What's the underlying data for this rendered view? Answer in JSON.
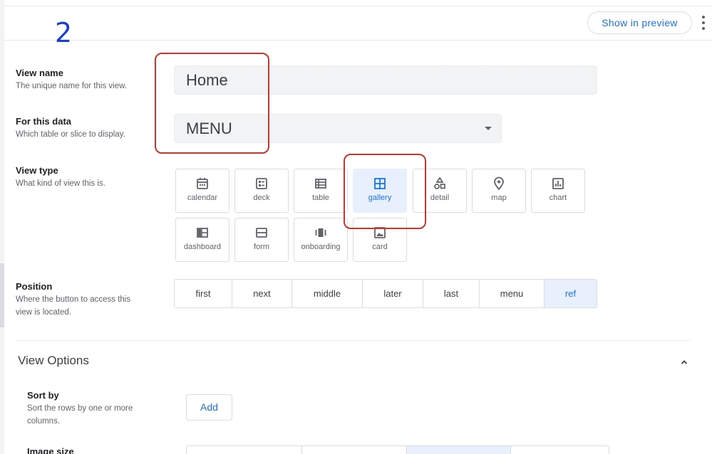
{
  "annotation": {
    "step_number": "2"
  },
  "header": {
    "show_in_preview_label": "Show in preview"
  },
  "view_name": {
    "title": "View name",
    "description": "The unique name for this view.",
    "value": "Home"
  },
  "for_this_data": {
    "title": "For this data",
    "description": "Which table or slice to display.",
    "value": "MENU"
  },
  "view_type": {
    "title": "View type",
    "description": "What kind of view this is.",
    "options": [
      {
        "label": "calendar",
        "icon": "calendar-icon"
      },
      {
        "label": "deck",
        "icon": "deck-icon"
      },
      {
        "label": "table",
        "icon": "table-icon"
      },
      {
        "label": "gallery",
        "icon": "gallery-icon"
      },
      {
        "label": "detail",
        "icon": "detail-icon"
      },
      {
        "label": "map",
        "icon": "map-pin-icon"
      },
      {
        "label": "chart",
        "icon": "chart-icon"
      },
      {
        "label": "dashboard",
        "icon": "dashboard-icon"
      },
      {
        "label": "form",
        "icon": "form-icon"
      },
      {
        "label": "onboarding",
        "icon": "onboarding-icon"
      },
      {
        "label": "card",
        "icon": "card-icon"
      }
    ],
    "selected": "gallery"
  },
  "position": {
    "title": "Position",
    "description_line1": "Where the button to access this",
    "description_line2": "view is located.",
    "options": [
      "first",
      "next",
      "middle",
      "later",
      "last",
      "menu",
      "ref"
    ],
    "selected": "ref"
  },
  "view_options": {
    "title": "View Options",
    "sort_by": {
      "title": "Sort by",
      "description_line1": "Sort the rows by one or more",
      "description_line2": "columns.",
      "add_label": "Add"
    },
    "image_size": {
      "title": "Image size"
    }
  },
  "colors": {
    "accent": "#1a73e8",
    "selected_bg": "#e8f0fe",
    "highlight": "#c0392b",
    "annotation": "#1a3fd1"
  }
}
